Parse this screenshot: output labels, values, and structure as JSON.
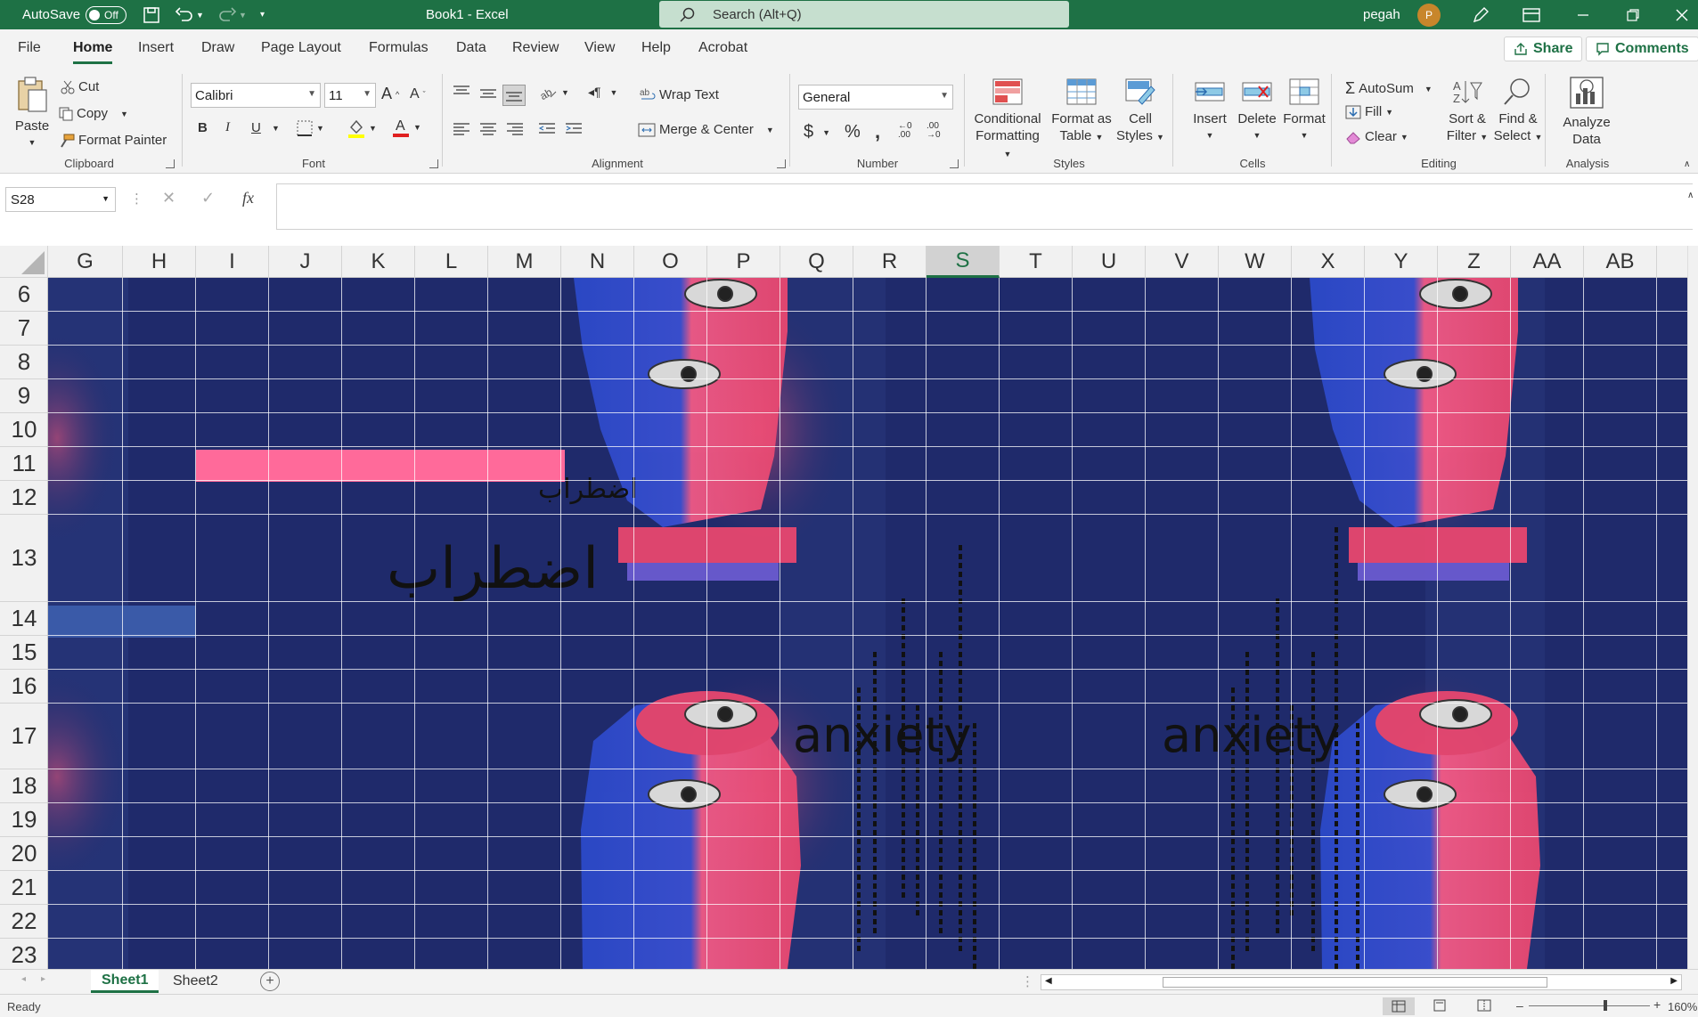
{
  "titlebar": {
    "autosave_label": "AutoSave",
    "autosave_state": "Off",
    "title": "Book1  -  Excel",
    "search_placeholder": "Search (Alt+Q)",
    "user_name": "pegah",
    "user_initial": "P"
  },
  "tabs": [
    "File",
    "Home",
    "Insert",
    "Draw",
    "Page Layout",
    "Formulas",
    "Data",
    "Review",
    "View",
    "Help",
    "Acrobat"
  ],
  "active_tab": "Home",
  "share_label": "Share",
  "comments_label": "Comments",
  "ribbon": {
    "clipboard": {
      "label": "Clipboard",
      "paste": "Paste",
      "cut": "Cut",
      "copy": "Copy",
      "format_painter": "Format Painter"
    },
    "font": {
      "label": "Font",
      "font_name": "Calibri",
      "font_size": "11",
      "bold": "B",
      "italic": "I",
      "underline": "U"
    },
    "alignment": {
      "label": "Alignment",
      "wrap_text": "Wrap Text",
      "merge_center": "Merge & Center"
    },
    "number": {
      "label": "Number",
      "format": "General"
    },
    "styles": {
      "label": "Styles",
      "conditional_1": "Conditional",
      "conditional_2": "Formatting",
      "format_table_1": "Format as",
      "format_table_2": "Table",
      "cell_styles_1": "Cell",
      "cell_styles_2": "Styles"
    },
    "cells": {
      "label": "Cells",
      "insert": "Insert",
      "delete": "Delete",
      "format": "Format"
    },
    "editing": {
      "label": "Editing",
      "autosum": "AutoSum",
      "fill": "Fill",
      "clear": "Clear",
      "sort_1": "Sort &",
      "sort_2": "Filter",
      "find_1": "Find &",
      "find_2": "Select"
    },
    "analysis": {
      "label": "Analysis",
      "analyze_1": "Analyze",
      "analyze_2": "Data"
    }
  },
  "formula_bar": {
    "name_box": "S28",
    "fx": "fx"
  },
  "columns": [
    "G",
    "H",
    "I",
    "J",
    "K",
    "L",
    "M",
    "N",
    "O",
    "P",
    "Q",
    "R",
    "S",
    "T",
    "U",
    "V",
    "W",
    "X",
    "Y",
    "Z",
    "AA",
    "AB"
  ],
  "selected_column": "S",
  "rows": [
    "6",
    "7",
    "8",
    "9",
    "10",
    "11",
    "12",
    "13",
    "14",
    "15",
    "16",
    "17",
    "18",
    "19",
    "20",
    "21",
    "22",
    "23"
  ],
  "art": {
    "persian_text": "اضطراب",
    "anxiety_word": "anxiety"
  },
  "sheets": [
    "Sheet1",
    "Sheet2"
  ],
  "active_sheet": "Sheet1",
  "status": {
    "ready": "Ready",
    "zoom": "160%"
  },
  "colors": {
    "excel_green": "#1e7145",
    "sheet_bg": "#1f2a6b",
    "pink_cell": "#ff6a9a",
    "blue_cell": "#3a5aa8"
  }
}
